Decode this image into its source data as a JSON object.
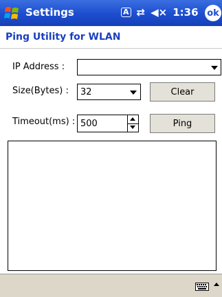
{
  "titlebar": {
    "title": "Settings",
    "input_indicator": "A",
    "connectivity_glyph": "⇄",
    "volume_glyph": "◀×",
    "time": "1:36",
    "ok_label": "ok"
  },
  "app": {
    "title": "Ping Utility for WLAN"
  },
  "form": {
    "ip_label": "IP Address   :",
    "ip_value": "",
    "size_label": "Size(Bytes)  :",
    "size_value": "32",
    "timeout_label": "Timeout(ms) :",
    "timeout_value": "500",
    "clear_label": "Clear",
    "ping_label": "Ping"
  },
  "output": {
    "text": ""
  },
  "icons": {
    "start": "windows-flag-icon",
    "keyboard": "keyboard-icon",
    "sip_toggle": "caret-up-icon"
  }
}
